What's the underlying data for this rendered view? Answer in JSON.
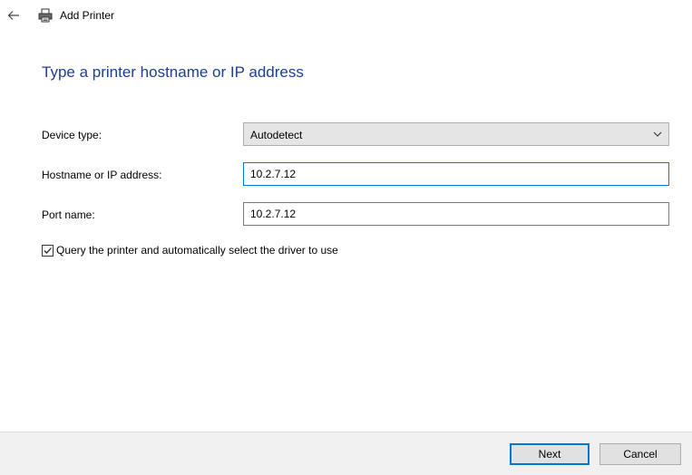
{
  "window": {
    "title": "Add Printer"
  },
  "page": {
    "heading": "Type a printer hostname or IP address"
  },
  "form": {
    "device_type_label": "Device type:",
    "device_type_value": "Autodetect",
    "hostname_label": "Hostname or IP address:",
    "hostname_value": "10.2.7.12",
    "port_label": "Port name:",
    "port_value": "10.2.7.12",
    "query_checkbox_label": "Query the printer and automatically select the driver to use",
    "query_checkbox_checked": true
  },
  "footer": {
    "next_label": "Next",
    "cancel_label": "Cancel"
  },
  "icons": {
    "back": "back-arrow-icon",
    "printer": "printer-icon",
    "dropdown": "chevron-down-icon",
    "check": "checkmark-icon"
  },
  "colors": {
    "heading": "#1c3f94",
    "focus_border": "#0078d7",
    "footer_bg": "#f0f0f0"
  }
}
